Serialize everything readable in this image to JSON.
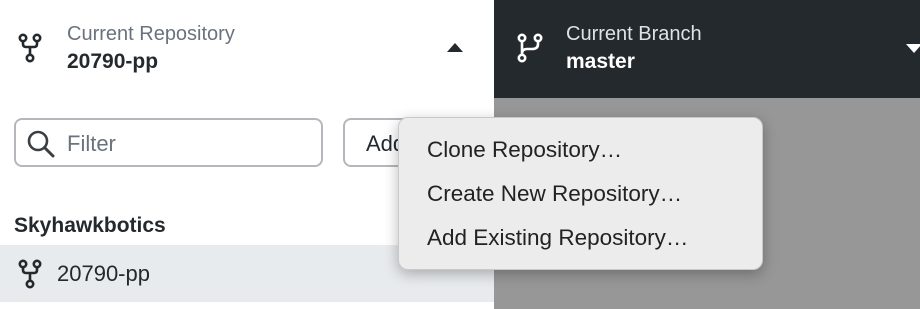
{
  "repository": {
    "caption": "Current Repository",
    "name": "20790-pp"
  },
  "branch": {
    "caption": "Current Branch",
    "name": "master"
  },
  "filter": {
    "placeholder": "Filter"
  },
  "add_button": {
    "label": "Add"
  },
  "repo_list": {
    "group": "Skyhawkbotics",
    "items": [
      {
        "label": "20790-pp"
      }
    ]
  },
  "menu": {
    "items": [
      {
        "label": "Clone Repository…"
      },
      {
        "label": "Create New Repository…"
      },
      {
        "label": "Add Existing Repository…"
      }
    ]
  },
  "colors": {
    "dark_header": "#24292e",
    "overlay": "#979797",
    "selected_row": "#e8ebee",
    "menu_bg": "#ececec"
  },
  "icons": {
    "repository": "repo-icon",
    "branch": "git-branch-icon",
    "search": "search-icon",
    "expand": "caret-up-icon",
    "branch_expand": "caret-down-icon"
  }
}
